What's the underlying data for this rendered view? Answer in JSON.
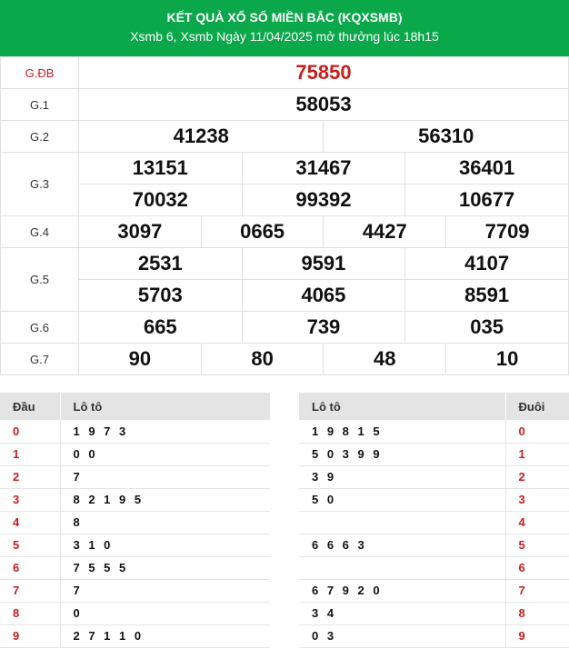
{
  "header": {
    "title": "KẾT QUẢ XỔ SỐ MIỀN BẮC (KQXSMB)",
    "subtitle": "Xsmb 6, Xsmb Ngày 11/04/2025 mở thưởng lúc 18h15"
  },
  "prizes": {
    "gdb": {
      "label": "G.ĐB",
      "numbers": [
        "75850"
      ]
    },
    "g1": {
      "label": "G.1",
      "numbers": [
        "58053"
      ]
    },
    "g2": {
      "label": "G.2",
      "numbers": [
        "41238",
        "56310"
      ]
    },
    "g3": {
      "label": "G.3",
      "numbers": [
        "13151",
        "31467",
        "36401",
        "70032",
        "99392",
        "10677"
      ]
    },
    "g4": {
      "label": "G.4",
      "numbers": [
        "3097",
        "0665",
        "4427",
        "7709"
      ]
    },
    "g5": {
      "label": "G.5",
      "numbers": [
        "2531",
        "9591",
        "4107",
        "5703",
        "4065",
        "8591"
      ]
    },
    "g6": {
      "label": "G.6",
      "numbers": [
        "665",
        "739",
        "035"
      ]
    },
    "g7": {
      "label": "G.7",
      "numbers": [
        "90",
        "80",
        "48",
        "10"
      ]
    }
  },
  "loto_head": {
    "col_key": "Đầu",
    "col_val": "Lô tô",
    "rows": [
      {
        "key": "0",
        "val": "1 9 7 3"
      },
      {
        "key": "1",
        "val": "0 0"
      },
      {
        "key": "2",
        "val": "7"
      },
      {
        "key": "3",
        "val": "8 2 1 9 5"
      },
      {
        "key": "4",
        "val": "8"
      },
      {
        "key": "5",
        "val": "3 1 0"
      },
      {
        "key": "6",
        "val": "7 5 5 5"
      },
      {
        "key": "7",
        "val": "7"
      },
      {
        "key": "8",
        "val": "0"
      },
      {
        "key": "9",
        "val": "2 7 1 1 0"
      }
    ]
  },
  "loto_tail": {
    "col_val": "Lô tô",
    "col_key": "Đuôi",
    "rows": [
      {
        "val": "1 9 8 1 5",
        "key": "0"
      },
      {
        "val": "5 0 3 9 9",
        "key": "1"
      },
      {
        "val": "3 9",
        "key": "2"
      },
      {
        "val": "5 0",
        "key": "3"
      },
      {
        "val": "",
        "key": "4"
      },
      {
        "val": "6 6 6 3",
        "key": "5"
      },
      {
        "val": "",
        "key": "6"
      },
      {
        "val": "6 7 9 2 0",
        "key": "7"
      },
      {
        "val": "3 4",
        "key": "8"
      },
      {
        "val": "0 3",
        "key": "9"
      }
    ]
  },
  "colors": {
    "header_bg": "#0aa84a",
    "special": "#c81e1e"
  }
}
